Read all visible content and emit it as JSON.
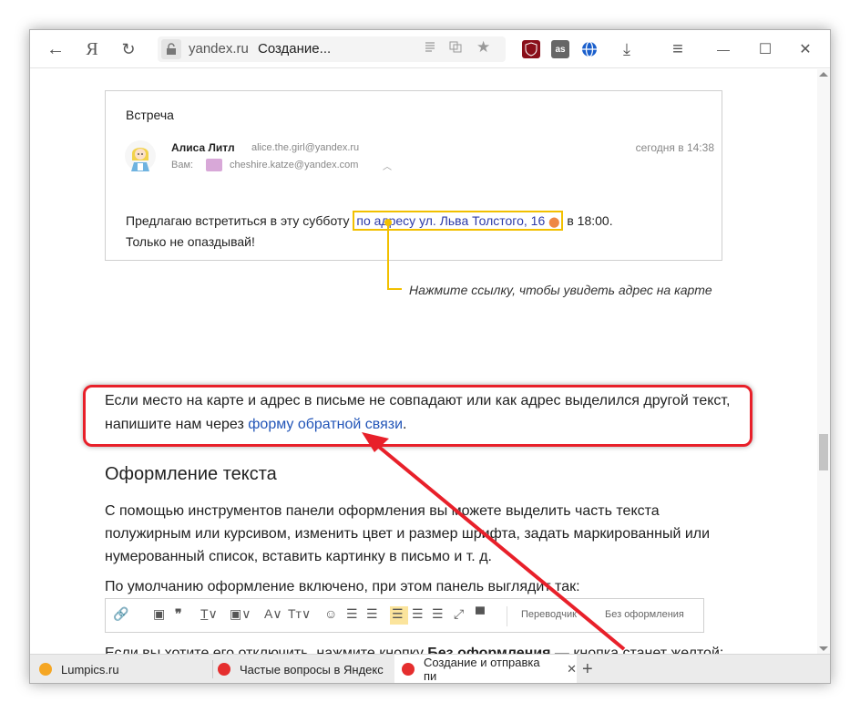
{
  "browser": {
    "nav": {
      "back_icon": "←",
      "yandex_icon": "Я",
      "reload_icon": "↻"
    },
    "address": {
      "domain": "yandex.ru",
      "title": "Создание..."
    },
    "controls": {
      "downloads_icon": "⤓",
      "menu_icon": "≡",
      "minimize_icon": "—",
      "maximize_icon": "☐",
      "close_icon": "✕"
    },
    "extension_labels": {
      "lastfm": "as"
    }
  },
  "mail": {
    "subject": "Встреча",
    "from_name": "Алиса Литл",
    "from_email": "alice.the.girl@yandex.ru",
    "date": "сегодня в 14:38",
    "to_label": "Вам:",
    "to_email": "cheshire.katze@yandex.com",
    "body_before": "Предлагаю встретиться в эту субботу ",
    "body_link": "по адресу ул. Льва Толстого, 16",
    "body_after": " в 18:00.",
    "body_line2": "Только не  опаздывай!"
  },
  "callout": "Нажмите ссылку, чтобы увидеть адрес на карте",
  "article": {
    "p1_l1": "Если место на карте и адрес в письме не совпадают или как адрес выделился другой текст,",
    "p1_l2_before": "напишите нам через ",
    "p1_link": "форму обратной связи",
    "p1_l2_after": ".",
    "heading": "Оформление текста",
    "p2_l1": "С помощью инструментов панели оформления вы можете выделить часть текста",
    "p2_l2": "полужирным или курсивом, изменить цвет и размер шрифта, задать маркированный или",
    "p2_l3": "нумерованный список, вставить картинку в письмо и т. д.",
    "p3": "По умолчанию оформление включено, при этом панель выглядит так:",
    "p4_before": "Если вы хотите его отключить, нажмите кнопку ",
    "p4_bold": "Без оформления",
    "p4_after": " — кнопка станет желтой:",
    "toolbar_translator": "Переводчик",
    "toolbar_plain": "Без оформления"
  },
  "tabs": [
    {
      "label": "Lumpics.ru",
      "color": "#f5a623"
    },
    {
      "label": "Частые вопросы в Яндекс",
      "color": "#e52e2e"
    },
    {
      "label": "Создание и отправка пи",
      "color": "#e52e2e"
    }
  ],
  "colors": {
    "accent_yellow": "#f2c000",
    "highlight_red": "#e8202a",
    "link": "#2255b8"
  }
}
